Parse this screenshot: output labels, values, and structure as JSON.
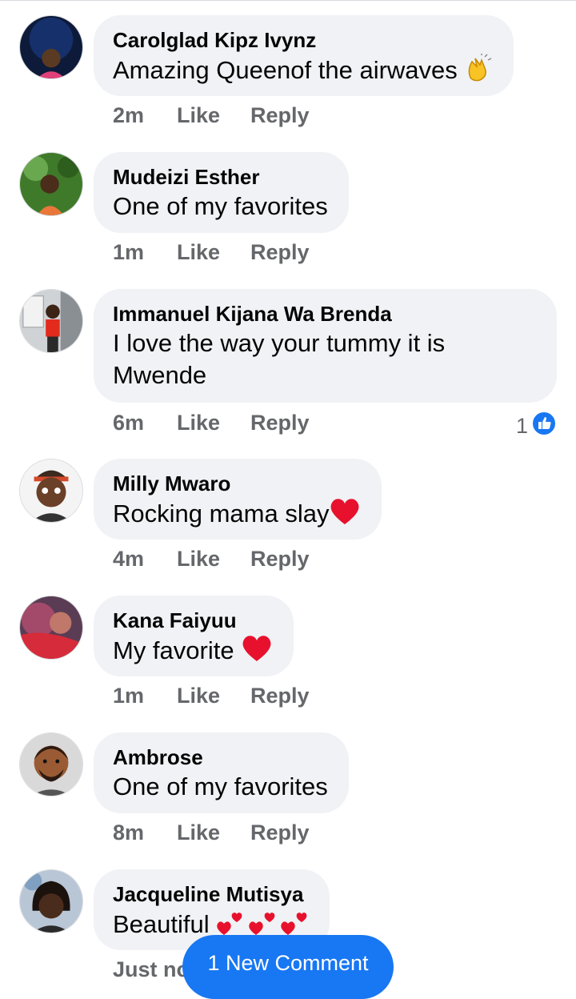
{
  "comments": [
    {
      "author": "Carolglad Kipz Ivynz",
      "text": "Amazing Queenof the airwaves",
      "emoji": "clapping-hands",
      "time": "2m",
      "like": "Like",
      "reply": "Reply"
    },
    {
      "author": "Mudeizi Esther",
      "text": "One of my favorites",
      "time": "1m",
      "like": "Like",
      "reply": "Reply"
    },
    {
      "author": "Immanuel Kijana Wa Brenda",
      "text_line1": "I love the way your tummy it is",
      "text_line2": "Mwende",
      "time": "6m",
      "like": "Like",
      "reply": "Reply",
      "reaction_count": "1"
    },
    {
      "author": "Milly Mwaro",
      "text": "Rocking mama slay",
      "emoji": "red-heart",
      "time": "4m",
      "like": "Like",
      "reply": "Reply"
    },
    {
      "author": "Kana Faiyuu",
      "text": "My favorite ",
      "emoji": "red-heart",
      "time": "1m",
      "like": "Like",
      "reply": "Reply"
    },
    {
      "author": "Ambrose",
      "text": "One of my favorites",
      "time": "8m",
      "like": "Like",
      "reply": "Reply"
    },
    {
      "author": "Jacqueline Mutisya",
      "text": "Beautiful ",
      "emoji": "hearts",
      "time": "Just no"
    }
  ],
  "new_comment_button": "1 New Comment",
  "colors": {
    "bubble": "#f0f2f5",
    "meta": "#65676b",
    "accent": "#1877f2",
    "heart": "#e8112d"
  }
}
